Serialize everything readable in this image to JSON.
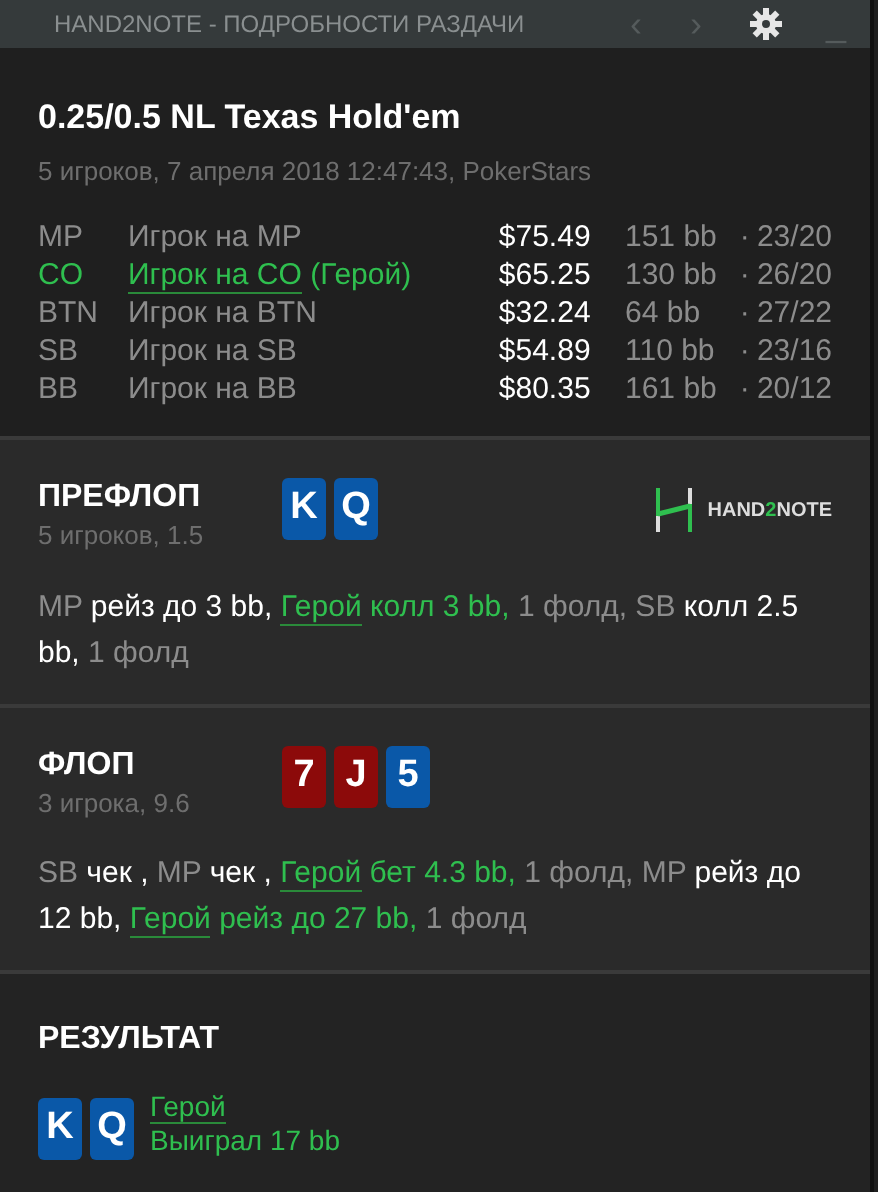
{
  "window": {
    "title": "HAND2NOTE - ПОДРОБНОСТИ РАЗДАЧИ",
    "prev": "‹",
    "next": "›",
    "minimize": "_"
  },
  "hand": {
    "title": "0.25/0.5 NL Texas Hold'em",
    "subtitle": "5 игроков, 7 апреля 2018 12:47:43, PokerStars"
  },
  "players": [
    {
      "position": "MP",
      "name": "Игрок на MP",
      "hero": false,
      "stack": "$75.49",
      "bb": "151 bb",
      "sep": "·",
      "stats": "23/20"
    },
    {
      "position": "CO",
      "name": "Игрок на CO",
      "hero_tag": "(Герой)",
      "hero": true,
      "stack": "$65.25",
      "bb": "130 bb",
      "sep": "·",
      "stats": "26/20"
    },
    {
      "position": "BTN",
      "name": "Игрок на BTN",
      "hero": false,
      "stack": "$32.24",
      "bb": "64 bb",
      "sep": "·",
      "stats": "27/22"
    },
    {
      "position": "SB",
      "name": "Игрок на SB",
      "hero": false,
      "stack": "$54.89",
      "bb": "110 bb",
      "sep": "·",
      "stats": "23/16"
    },
    {
      "position": "BB",
      "name": "Игрок на BB",
      "hero": false,
      "stack": "$80.35",
      "bb": "161 bb",
      "sep": "·",
      "stats": "20/12"
    }
  ],
  "streets": [
    {
      "title": "ПРЕФЛОП",
      "subtitle": "5 игроков, 1.5",
      "logo": {
        "before": "HAND",
        "accent": "2",
        "after": "NOTE"
      },
      "cards": [
        {
          "rank": "K",
          "color": "#0a58a8"
        },
        {
          "rank": "Q",
          "color": "#0a58a8"
        }
      ],
      "actions": [
        {
          "kind": "position",
          "text": "MP"
        },
        {
          "kind": "action",
          "text": " рейз до 3 bb,"
        },
        {
          "kind": "hero-link",
          "text": "Герой"
        },
        {
          "kind": "hero-action",
          "text": " колл 3 bb,"
        },
        {
          "kind": "fold",
          "text": " 1 фолд,"
        },
        {
          "kind": "position",
          "text": " SB"
        },
        {
          "kind": "action",
          "text": " колл 2.5 bb,"
        },
        {
          "kind": "fold",
          "text": " 1 фолд"
        }
      ]
    },
    {
      "title": "ФЛОП",
      "subtitle": "3 игрока, 9.6",
      "cards": [
        {
          "rank": "7",
          "color": "#8c0a0a"
        },
        {
          "rank": "J",
          "color": "#8c0a0a"
        },
        {
          "rank": "5",
          "color": "#0a58a8"
        }
      ],
      "actions": [
        {
          "kind": "position",
          "text": "SB"
        },
        {
          "kind": "action",
          "text": " чек ,"
        },
        {
          "kind": "position",
          "text": " MP"
        },
        {
          "kind": "action",
          "text": " чек ,"
        },
        {
          "kind": "hero-link",
          "text": "Герой"
        },
        {
          "kind": "hero-action",
          "text": " бет 4.3 bb,"
        },
        {
          "kind": "fold",
          "text": " 1 фолд,"
        },
        {
          "kind": "position",
          "text": " MP"
        },
        {
          "kind": "action",
          "text": " рейз до 12 bb,"
        },
        {
          "kind": "hero-link",
          "text": "Герой"
        },
        {
          "kind": "hero-action",
          "text": " рейз до 27 bb,"
        },
        {
          "kind": "fold",
          "text": " 1 фолд"
        }
      ]
    }
  ],
  "result": {
    "title": "РЕЗУЛЬТАТ",
    "cards": [
      {
        "rank": "K",
        "color": "#0a58a8"
      },
      {
        "rank": "Q",
        "color": "#0a58a8"
      }
    ],
    "player": "Герой",
    "outcome": "Выиграл 17 bb"
  }
}
